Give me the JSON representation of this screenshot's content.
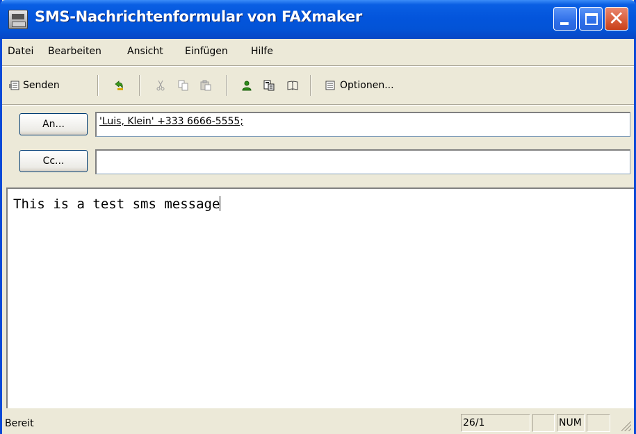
{
  "window": {
    "title": "SMS-Nachrichtenformular von FAXmaker",
    "close_glyph": "✕"
  },
  "menu": {
    "items": [
      "Datei",
      "Bearbeiten",
      "Ansicht",
      "Einfügen",
      "Hilfe"
    ]
  },
  "toolbar": {
    "send_label": "Senden",
    "options_label": "Optionen...",
    "icons": [
      "send-icon",
      "undo-icon",
      "cut-icon",
      "copy-icon",
      "paste-icon",
      "address-book-icon",
      "check-names-icon",
      "book-icon",
      "options-icon"
    ]
  },
  "to": {
    "button_label": "An...",
    "value": "'Luis, Klein' +333 6666-5555;"
  },
  "cc": {
    "button_label": "Cc...",
    "value": ""
  },
  "message": {
    "text": "This is a test sms message"
  },
  "status": {
    "text": "Bereit",
    "position": "26/1",
    "num": "NUM"
  },
  "colors": {
    "title_bar": "#0355dc",
    "window_bg": "#ece9d8",
    "close_button": "#d85c38"
  }
}
